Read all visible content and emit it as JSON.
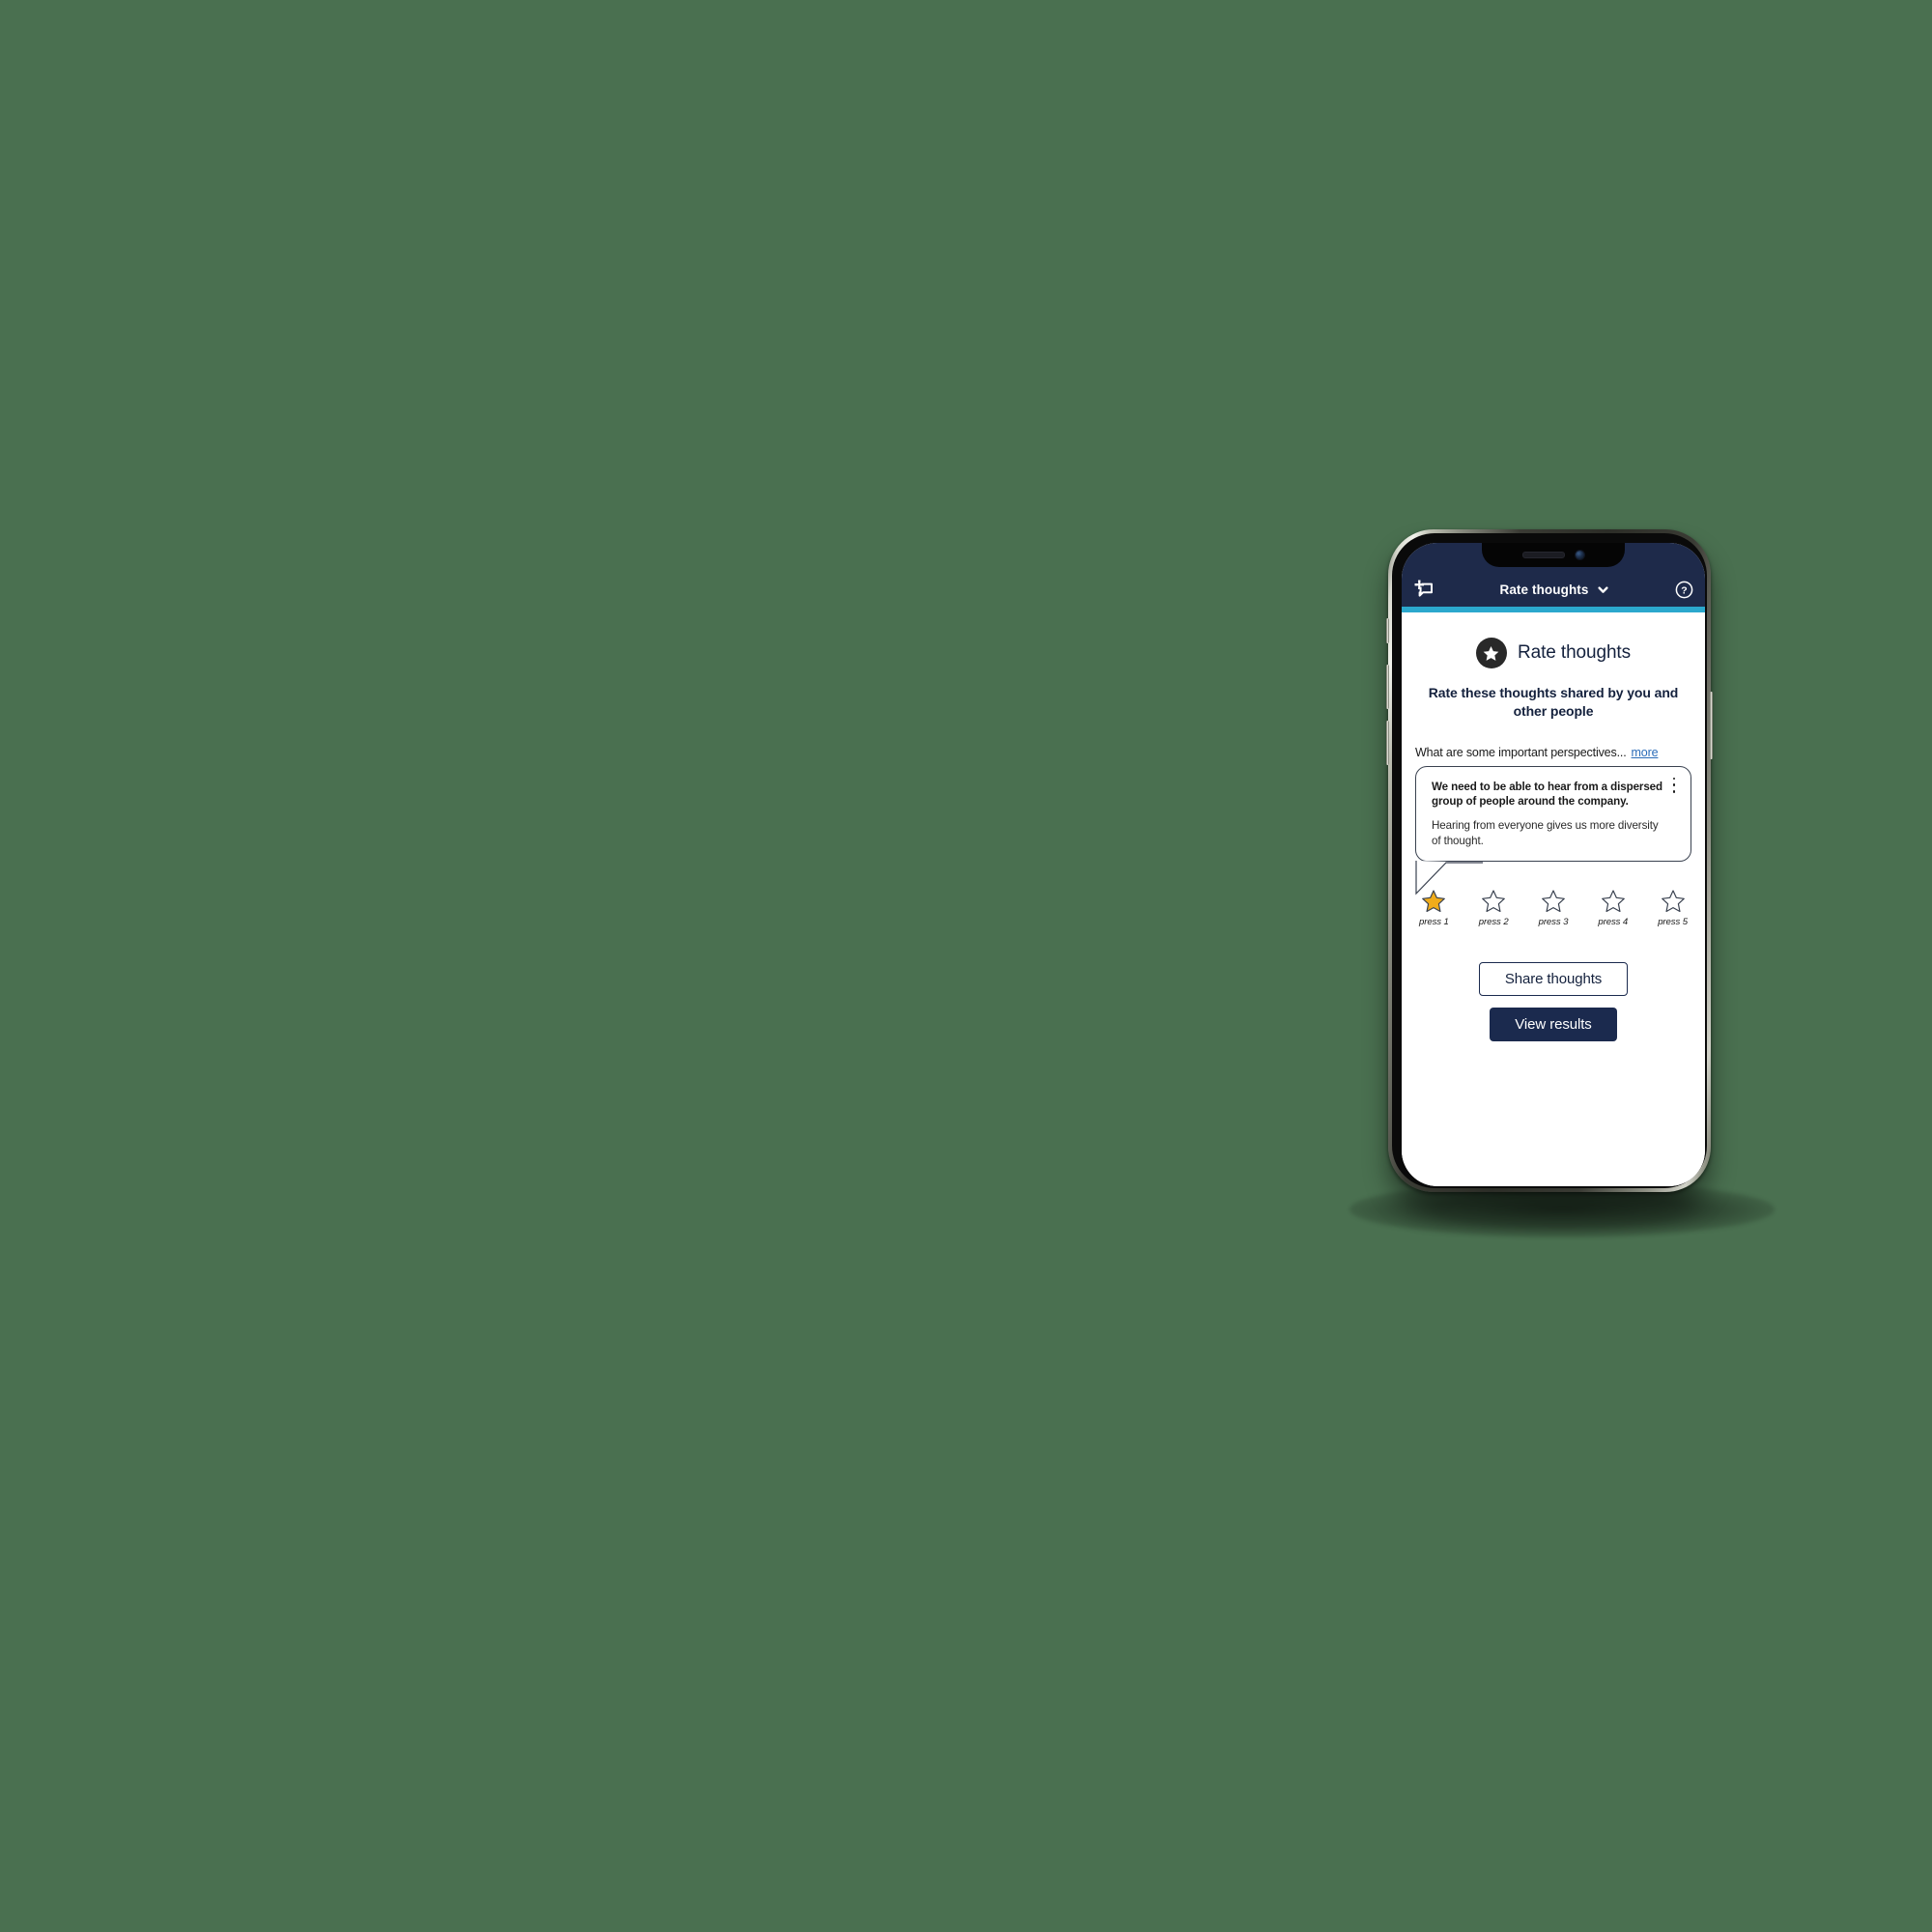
{
  "background_color": "#4a7050",
  "theme": {
    "navy": "#1e2a4a",
    "cyan": "#2ba8cd",
    "gold": "#f0ac1b",
    "link_blue": "#2b6cb8",
    "star_outline": "#3a4250"
  },
  "device": {
    "notch": {
      "speaker_icon": "speaker-grille-icon",
      "camera_icon": "front-camera-icon"
    }
  },
  "header": {
    "new_thought_icon": "new-thought-bubble-plus-icon",
    "title": "Rate thoughts",
    "dropdown_icon": "chevron-down-icon",
    "help_icon": "help-circle-icon"
  },
  "main": {
    "badge_icon": "star-badge-icon",
    "title": "Rate thoughts",
    "subtitle": "Rate these thoughts shared by you and other people",
    "question": {
      "text": "What are some important perspectives...",
      "more_label": "more"
    },
    "thought_card": {
      "title": "We need to be able to hear from a dispersed group of people around the company.",
      "body": "Hearing from everyone gives us more diversity of thought.",
      "menu_icon": "kebab-menu-icon"
    },
    "rating": {
      "selected": 1,
      "options": [
        {
          "value": 1,
          "label": "press 1",
          "filled": true
        },
        {
          "value": 2,
          "label": "press 2",
          "filled": false
        },
        {
          "value": 3,
          "label": "press 3",
          "filled": false
        },
        {
          "value": 4,
          "label": "press 4",
          "filled": false
        },
        {
          "value": 5,
          "label": "press 5",
          "filled": false
        }
      ]
    },
    "actions": {
      "share_label": "Share thoughts",
      "view_results_label": "View results"
    }
  }
}
